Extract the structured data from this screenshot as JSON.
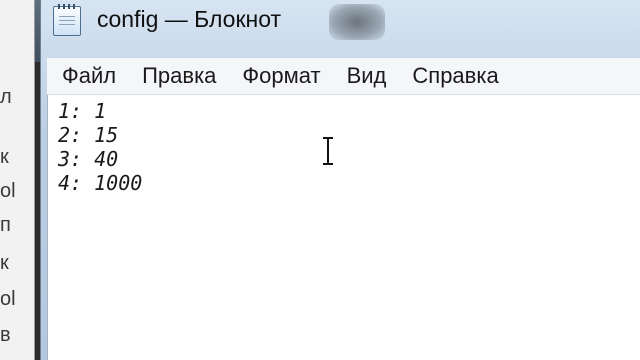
{
  "background_window": {
    "chars": [
      "л",
      "к",
      "ol",
      "п",
      "к",
      "ol",
      "в"
    ]
  },
  "window": {
    "title": "config — Блокнот"
  },
  "menu": {
    "items": [
      {
        "label": "Файл"
      },
      {
        "label": "Правка"
      },
      {
        "label": "Формат"
      },
      {
        "label": "Вид"
      },
      {
        "label": "Справка"
      }
    ]
  },
  "editor": {
    "lines": [
      "1: 1",
      "2: 15",
      "3: 40",
      "4: 1000"
    ]
  }
}
